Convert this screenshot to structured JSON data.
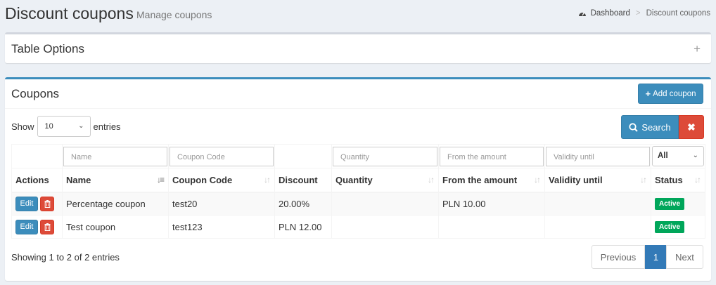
{
  "header": {
    "title": "Discount coupons",
    "subtitle": "Manage coupons",
    "breadcrumb": {
      "home": "Dashboard",
      "current": "Discount coupons",
      "home_icon": "dashboard-icon"
    }
  },
  "table_options": {
    "title": "Table Options",
    "toggle": "+"
  },
  "coupons": {
    "title": "Coupons",
    "add_button": "Add coupon",
    "add_icon": "+",
    "show_label": "Show",
    "entries_label": "entries",
    "page_length": "10",
    "search_button": "Search",
    "clear_button": "✖",
    "filters": {
      "name": "Name",
      "code": "Coupon Code",
      "quantity": "Quantity",
      "from_amount": "From the amount",
      "validity": "Validity until",
      "status": "All"
    },
    "columns": [
      "Actions",
      "Name",
      "Coupon Code",
      "Discount",
      "Quantity",
      "From the amount",
      "Validity until",
      "Status"
    ],
    "edit_label": "Edit",
    "rows": [
      {
        "name": "Percentage coupon",
        "code": "test20",
        "discount": "20.00%",
        "quantity": "",
        "from_amount": "PLN 10.00",
        "validity": "",
        "status": "Active"
      },
      {
        "name": "Test coupon",
        "code": "test123",
        "discount": "PLN 12.00",
        "quantity": "",
        "from_amount": "",
        "validity": "",
        "status": "Active"
      }
    ],
    "info": "Showing 1 to 2 of 2 entries",
    "pagination": {
      "previous": "Previous",
      "page": "1",
      "next": "Next"
    }
  },
  "colors": {
    "primary": "#3c8dbc",
    "danger": "#dd4b39",
    "success": "#00a65a",
    "page_active": "#337ab7"
  }
}
